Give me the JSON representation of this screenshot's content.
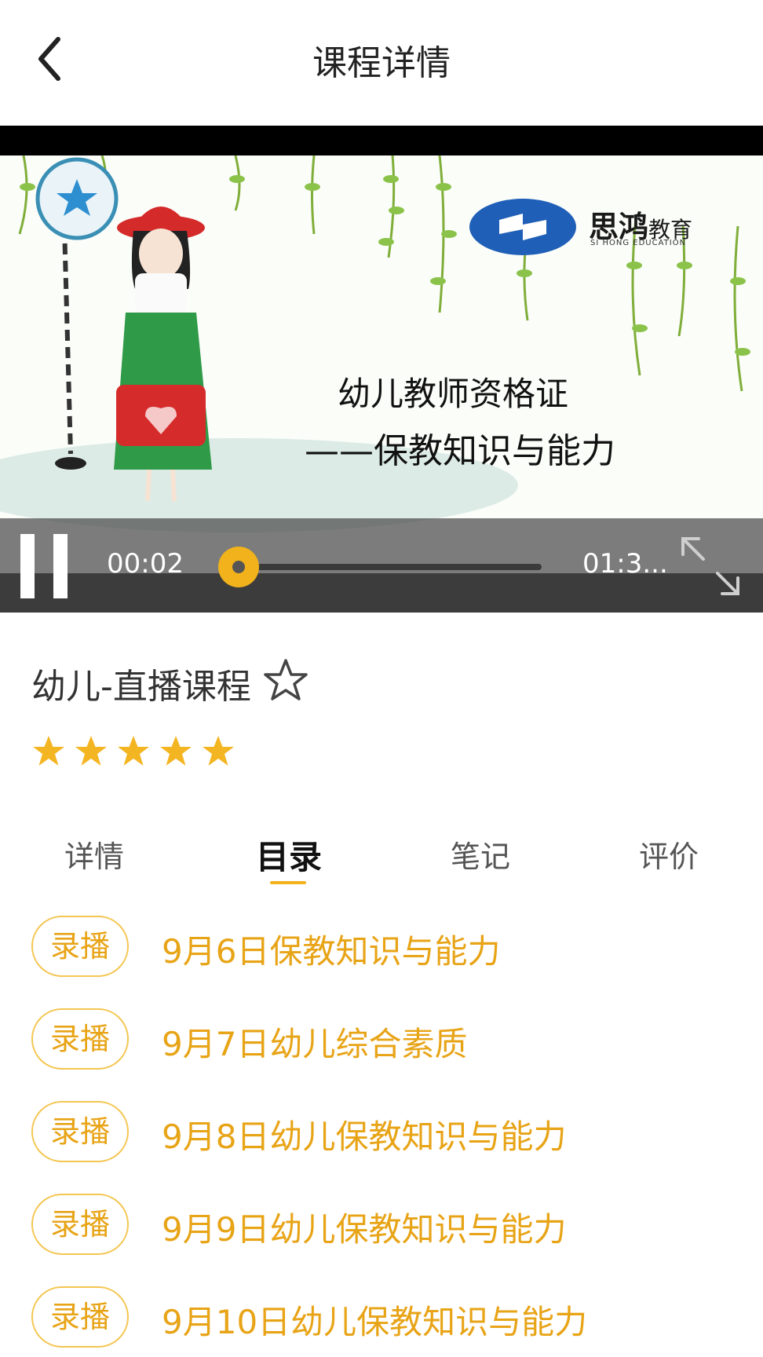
{
  "header": {
    "title": "课程详情",
    "back_icon": "chevron-left-icon"
  },
  "video": {
    "slide_title": "幼儿教师资格证",
    "slide_subtitle": "——保教知识与能力",
    "brand_name": "思鸿",
    "brand_suffix": "教育",
    "brand_en": "SI HONG EDUCATION",
    "current_time": "00:02",
    "total_time": "01:3...",
    "progress": 0.03,
    "accent_color": "#f2b21b"
  },
  "course": {
    "title": "幼儿-直播课程",
    "rating": 5,
    "rating_max": 5,
    "star_color": "#f4b522"
  },
  "tabs": [
    {
      "label": "详情",
      "active": false
    },
    {
      "label": "目录",
      "active": true
    },
    {
      "label": "笔记",
      "active": false
    },
    {
      "label": "评价",
      "active": false
    }
  ],
  "lessons": [
    {
      "badge": "录播",
      "title": "9月6日保教知识与能力"
    },
    {
      "badge": "录播",
      "title": "9月7日幼儿综合素质"
    },
    {
      "badge": "录播",
      "title": "9月8日幼儿保教知识与能力"
    },
    {
      "badge": "录播",
      "title": "9月9日幼儿保教知识与能力"
    },
    {
      "badge": "录播",
      "title": "9月10日幼儿保教知识与能力"
    }
  ]
}
